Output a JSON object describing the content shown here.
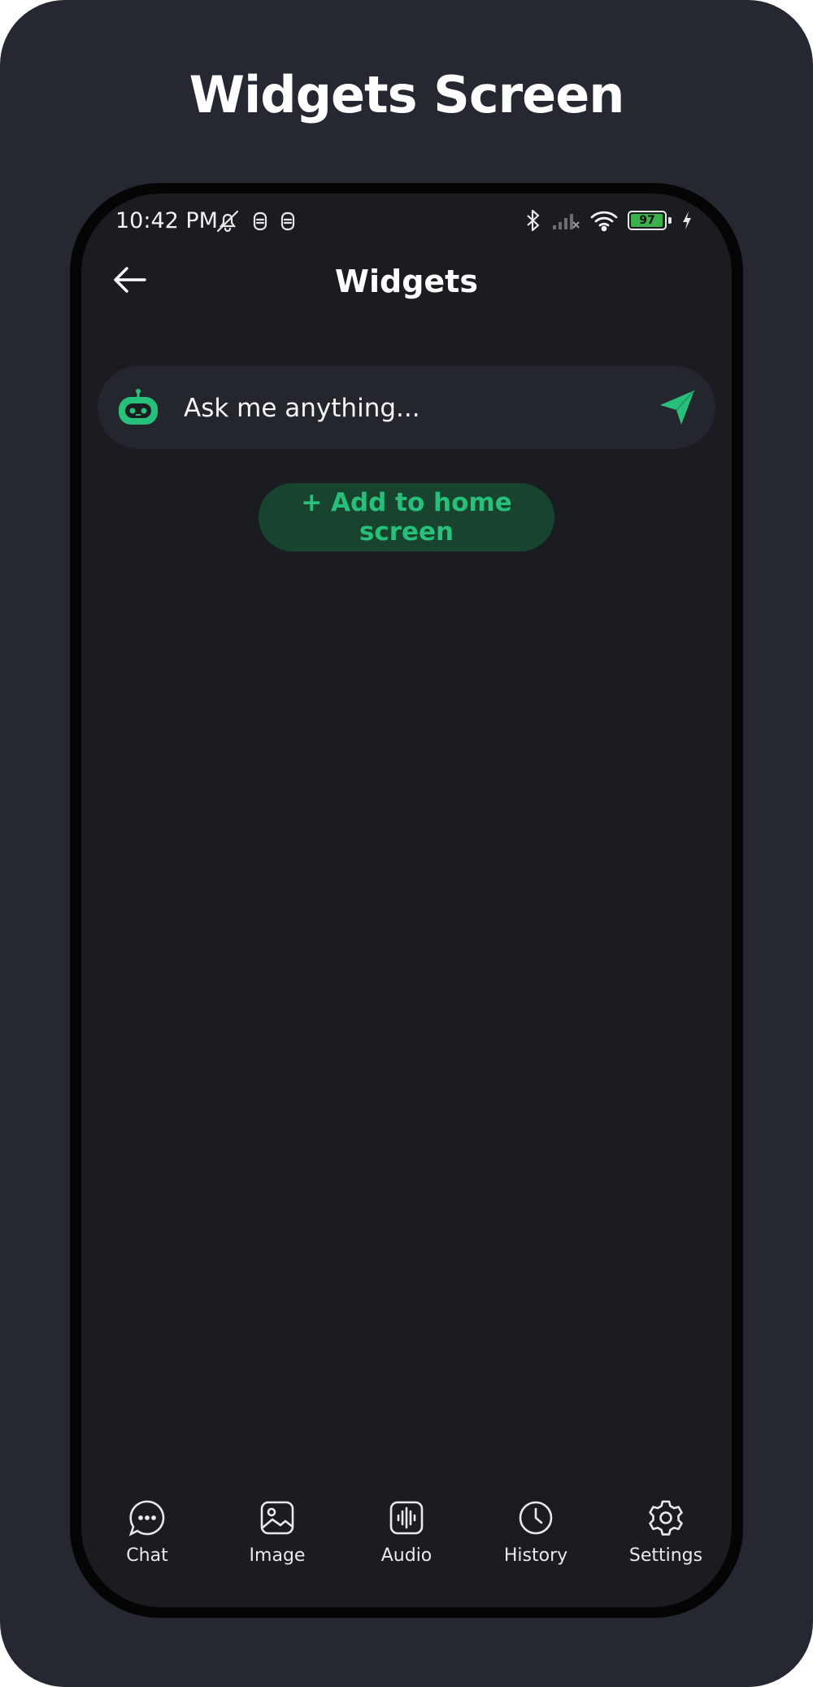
{
  "headline": "Widgets Screen",
  "status_bar": {
    "time": "10:42 PM",
    "battery_level": "97",
    "left_icons": [
      "mute-icon",
      "notification-icon",
      "notification-icon"
    ],
    "right_icons": [
      "bluetooth-icon",
      "signal-icon",
      "wifi-icon",
      "battery-icon",
      "charging-icon"
    ]
  },
  "app_bar": {
    "title": "Widgets",
    "back_icon": "arrow-left-icon"
  },
  "widget": {
    "placeholder": "Ask me anything...",
    "bot_icon": "robot-icon",
    "send_icon": "send-icon",
    "accent_color": "#26c07a"
  },
  "add_to_home_label": "+ Add to home screen",
  "bottom_nav": {
    "items": [
      {
        "label": "Chat",
        "icon": "chat-icon"
      },
      {
        "label": "Image",
        "icon": "image-icon"
      },
      {
        "label": "Audio",
        "icon": "audio-icon"
      },
      {
        "label": "History",
        "icon": "history-icon"
      },
      {
        "label": "Settings",
        "icon": "settings-icon"
      }
    ]
  }
}
